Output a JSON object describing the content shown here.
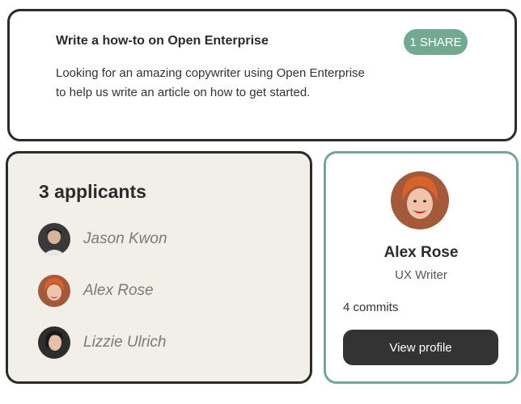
{
  "task": {
    "title": "Write a how-to on Open Enterprise",
    "share_label": "1 SHARE",
    "description_line1": "Looking for an amazing copywriter using Open Enterprise",
    "description_line2": "to help us write an article on how to get started."
  },
  "applicants": {
    "count_label": "3 applicants",
    "list": [
      {
        "name": "Jason Kwon",
        "avatar": "person-photo"
      },
      {
        "name": "Alex Rose",
        "avatar": "person-photo"
      },
      {
        "name": "Lizzie Ulrich",
        "avatar": "person-photo"
      }
    ]
  },
  "profile": {
    "name": "Alex Rose",
    "role": "UX Writer",
    "commits": "4 commits",
    "button_label": "View profile"
  },
  "colors": {
    "accent": "#73a993",
    "dark": "#2b2b2b",
    "applicants_bg": "#f2efe9"
  }
}
